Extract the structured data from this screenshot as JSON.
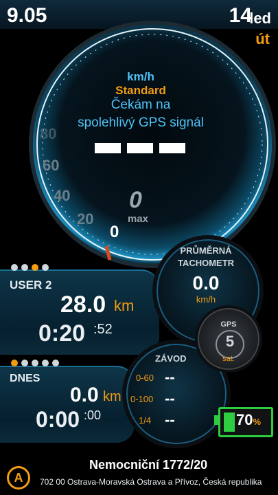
{
  "status": {
    "time": "9.05",
    "date_day": "14",
    "date_month": "led",
    "weekday": "út"
  },
  "speedometer": {
    "unit": "km/h",
    "mode": "Standard",
    "message_line1": "Čekám na",
    "message_line2": "spolehlivý GPS signál",
    "current_speed": "---",
    "scale_labels": [
      "20",
      "40",
      "60",
      "80"
    ],
    "max_value": "0",
    "max_label": "max",
    "needle_value": "0"
  },
  "average": {
    "title_line1": "PRŮMĚRNÁ",
    "title_line2": "TACHOMETR",
    "value": "0.0",
    "unit": "km/h"
  },
  "trip_user": {
    "label": "USER 2",
    "distance": "28.0",
    "distance_unit": "km",
    "time_main": "0:20",
    "time_sec": ":52"
  },
  "trip_today": {
    "label": "DNES",
    "distance": "0.0",
    "distance_unit": "km",
    "time_main": "0:00",
    "time_sec": ":00"
  },
  "race": {
    "title": "ZÁVOD",
    "rows": [
      {
        "label": "0-60",
        "value": "--"
      },
      {
        "label": "0-100",
        "value": "--"
      },
      {
        "label": "1/4",
        "value": "--"
      }
    ]
  },
  "gps": {
    "label": "GPS",
    "count": "5",
    "unit": "sat."
  },
  "battery": {
    "value": "70",
    "unit": "%",
    "level_fraction": 0.7
  },
  "address": {
    "street": "Nemocniční 1772/20",
    "detail": "702 00 Ostrava-Moravská Ostrava a Přívoz, Česká republika",
    "badge": "A"
  },
  "colors": {
    "accent": "#f39c12",
    "blue": "#4fc3f7",
    "battery": "#2ecc40",
    "needle": "#d94a1a"
  }
}
